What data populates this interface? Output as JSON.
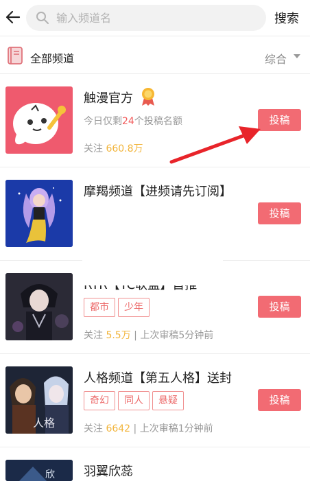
{
  "header": {
    "search_placeholder": "输入频道名",
    "search_button": "搜索"
  },
  "filter": {
    "all_channels": "全部频道",
    "sort_label": "综合"
  },
  "submit_label": "投稿",
  "channels": [
    {
      "title": "触漫官方",
      "sub_prefix": "今日仅剩",
      "sub_highlight": "24",
      "sub_suffix": "个投稿名额",
      "stat_label": "关注",
      "stat_value": "660.8万"
    },
    {
      "title": "摩羯频道【进频请先订阅】"
    },
    {
      "title": "RTR【TC联盟】首推",
      "tags": [
        "都市",
        "少年"
      ],
      "stat_label": "关注",
      "stat_value": "5.5万",
      "stat_suffix": " | 上次审稿5分钟前"
    },
    {
      "title": "人格频道【第五人格】送封",
      "tags": [
        "奇幻",
        "同人",
        "悬疑"
      ],
      "stat_label": "关注",
      "stat_value": "6642",
      "stat_suffix": " | 上次审稿1分钟前"
    },
    {
      "title": "羽翼欣蕊"
    }
  ],
  "colors": {
    "accent": "#f26b73",
    "highlight_number": "#f2b53c",
    "red_text": "#f25a5a",
    "arrow": "#e8242a"
  }
}
